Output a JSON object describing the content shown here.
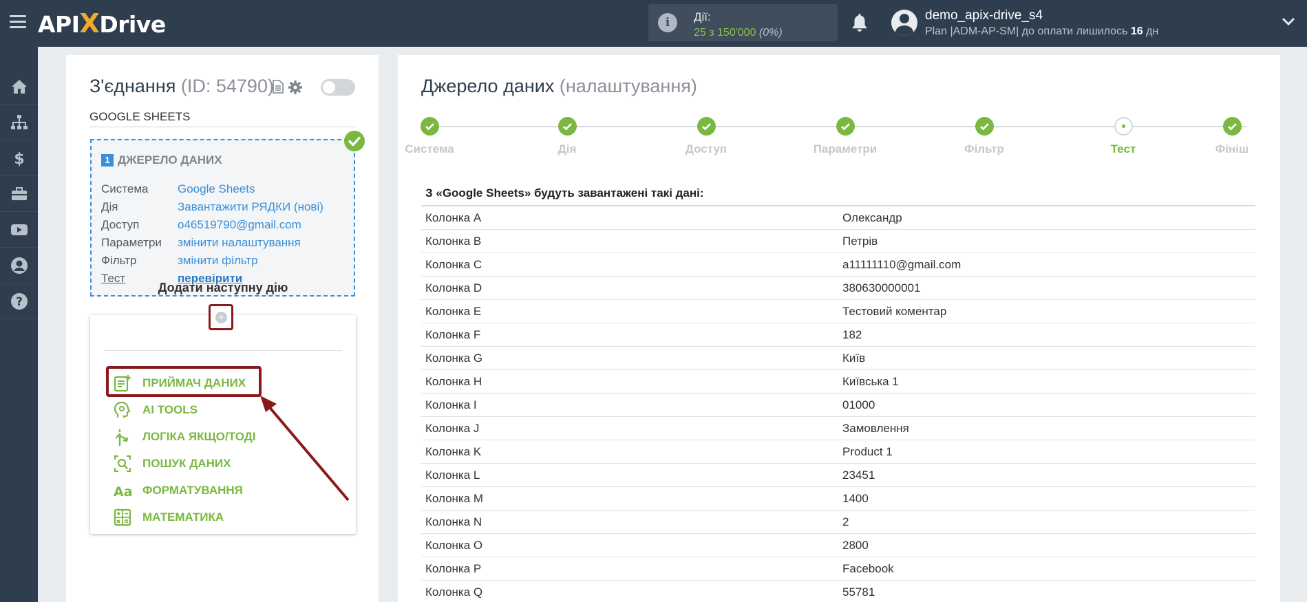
{
  "header": {
    "logo_left": "API",
    "logo_x": "X",
    "logo_right": "Drive",
    "actions_label": "Дії:",
    "actions_count": "25 з 150'000",
    "actions_percent": "(0%)",
    "username": "demo_apix-drive_s4",
    "plan_prefix": "Plan |ADM-AP-SM| до оплати лишилось ",
    "plan_days": "16",
    "plan_suffix": " дн"
  },
  "sidebar": {
    "icons": [
      "home-icon",
      "sitemap-icon",
      "dollar-icon",
      "briefcase-icon",
      "youtube-icon",
      "user-icon",
      "help-icon"
    ]
  },
  "connection": {
    "title": "З'єднання",
    "id_text": "(ID: 54790)",
    "name": "GOOGLE SHEETS",
    "source_number": "1",
    "source_heading": "ДЖЕРЕЛО ДАНИХ",
    "rows": [
      {
        "key": "Система",
        "value": "Google Sheets"
      },
      {
        "key": "Дія",
        "value": "Завантажити РЯДКИ (нові)"
      },
      {
        "key": "Доступ",
        "value": "o46519790@gmail.com"
      },
      {
        "key": "Параметри",
        "value": "змінити налаштування"
      },
      {
        "key": "Фільтр",
        "value": "змінити фільтр"
      },
      {
        "key": "Тест",
        "value": "перевірити"
      }
    ]
  },
  "add_action": {
    "plus": "+",
    "title": "Додати наступну дію",
    "items": [
      {
        "label": "ПРИЙМАЧ ДАНИХ",
        "icon": "data-receiver-icon"
      },
      {
        "label": "AI TOOLS",
        "icon": "ai-head-icon"
      },
      {
        "label": "ЛОГІКА ЯКЩО/ТОДІ",
        "icon": "branch-icon"
      },
      {
        "label": "ПОШУК ДАНИХ",
        "icon": "search-data-icon"
      },
      {
        "label": "ФОРМАТУВАННЯ",
        "icon": "text-format-icon"
      },
      {
        "label": "МАТЕМАТИКА",
        "icon": "calculator-icon"
      }
    ]
  },
  "source_settings": {
    "title": "Джерело даних",
    "subtitle": "(налаштування)",
    "steps": [
      "Система",
      "Дія",
      "Доступ",
      "Параметри",
      "Фільтр",
      "Тест",
      "Фініш"
    ],
    "current_step": "Тест",
    "data_heading": "З «Google Sheets» будуть завантажені такі дані:",
    "rows": [
      {
        "col": "Колонка A",
        "val": "Олександр"
      },
      {
        "col": "Колонка B",
        "val": "Петрів"
      },
      {
        "col": "Колонка C",
        "val": "a11111110@gmail.com"
      },
      {
        "col": "Колонка D",
        "val": "380630000001"
      },
      {
        "col": "Колонка E",
        "val": "Тестовий коментар"
      },
      {
        "col": "Колонка F",
        "val": "182"
      },
      {
        "col": "Колонка G",
        "val": "Київ"
      },
      {
        "col": "Колонка H",
        "val": "Київська 1"
      },
      {
        "col": "Колонка I",
        "val": "01000"
      },
      {
        "col": "Колонка J",
        "val": "Замовлення"
      },
      {
        "col": "Колонка K",
        "val": "Product 1"
      },
      {
        "col": "Колонка L",
        "val": "23451"
      },
      {
        "col": "Колонка M",
        "val": "1400"
      },
      {
        "col": "Колонка N",
        "val": "2"
      },
      {
        "col": "Колонка O",
        "val": "2800"
      },
      {
        "col": "Колонка P",
        "val": "Facebook"
      },
      {
        "col": "Колонка Q",
        "val": "55781"
      }
    ]
  },
  "colors": {
    "topbar": "#2f3e4e",
    "accent_green": "#7ab842",
    "accent_blue": "#3b8fd9",
    "highlight_red": "#8a1a1a"
  }
}
